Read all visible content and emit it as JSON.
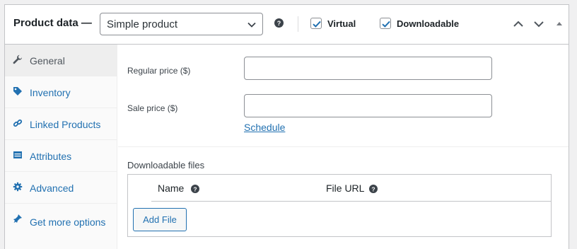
{
  "header": {
    "title": "Product data —",
    "product_type": "Simple product",
    "virtual_label": "Virtual",
    "virtual_checked": true,
    "downloadable_label": "Downloadable",
    "downloadable_checked": true
  },
  "sidebar": {
    "items": [
      {
        "label": "General",
        "icon": "wrench-icon",
        "active": true
      },
      {
        "label": "Inventory",
        "icon": "tag-icon",
        "active": false
      },
      {
        "label": "Linked Products",
        "icon": "link-icon",
        "active": false
      },
      {
        "label": "Attributes",
        "icon": "table-icon",
        "active": false
      },
      {
        "label": "Advanced",
        "icon": "gear-icon",
        "active": false
      },
      {
        "label": "Get more options",
        "icon": "plugin-icon",
        "active": false
      }
    ]
  },
  "general": {
    "regular_price_label": "Regular price ($)",
    "regular_price_value": "",
    "sale_price_label": "Sale price ($)",
    "sale_price_value": "",
    "schedule_link": "Schedule"
  },
  "downloads": {
    "section_label": "Downloadable files",
    "col_name": "Name",
    "col_url": "File URL",
    "add_button": "Add File"
  },
  "colors": {
    "accent": "#2271b1",
    "text": "#1d2327",
    "border": "#c3c4c7"
  }
}
